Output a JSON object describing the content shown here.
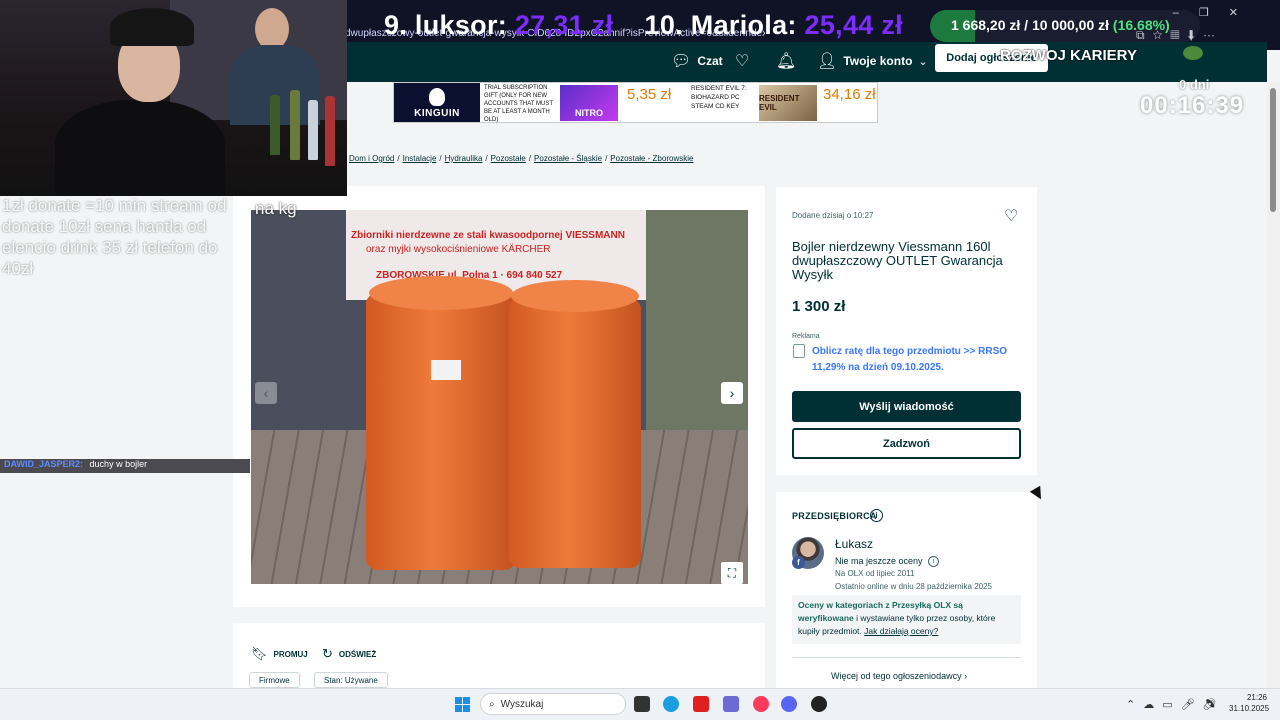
{
  "browser": {
    "url_text": "dwupłaszczowy-outlet-gwarancja-wysylk-CID628-ID2pxC2ahnif?isPreviewActive=0&sliderIndex=1"
  },
  "stream": {
    "scores": [
      {
        "rank_name": "9. luksor:",
        "amount": "27,31 zł"
      },
      {
        "rank_name": "10. Mariola:",
        "amount": "25,44 zł"
      }
    ],
    "goal": {
      "current": "1 668,20 zł",
      "sep": "/",
      "target": "10 000,00 zł",
      "percent": "(16.68%)",
      "progress": 0.1668
    },
    "kariery_label": "ROZWOJ KARIERY",
    "timer_small": "0 dni",
    "timer": "00:16:39",
    "overlay_text": "1zł donate =10 min stream od donate 10zł sena hantla od elencio drink 35 zł telefon do 40zł",
    "overlay_kg": "na kg",
    "chat_user": "DAWID_JASPER2:",
    "chat_msg": "duchy w bojler"
  },
  "header": {
    "chat_label": "Czat",
    "account_label": "Twoje konto",
    "add_label": "Dodaj ogłoszenie"
  },
  "ad_banner": {
    "brand": "KINGUIN",
    "product1_text": "TRIAL SUBSCRIPTION GIFT (ONLY FOR NEW ACCOUNTS THAT MUST BE AT LEAST A MONTH OLD)",
    "product1_image": "NITRO",
    "product1_price": "5,35 zł",
    "product2_text": "RESIDENT EVIL 7: BIOHAZARD PC STEAM CD KEY",
    "product2_image": "RESIDENT EVIL",
    "product2_price": "34,16 zł"
  },
  "breadcrumb": [
    "Dom i Ogród",
    "Instalacje",
    "Hydraulika",
    "Pozostałe",
    "Pozostałe - Śląskie",
    "Pozostałe - Zborowskie"
  ],
  "photo": {
    "banner_line1": "Zbiorniki nierdzewne ze stali kwasoodpornej VIESSMANN",
    "banner_line2": "oraz myjki wysokociśnieniowe KÄRCHER",
    "banner_contact": "ZBOROWSKIE ul. Polna 1 · 694 840 527"
  },
  "listing": {
    "added": "Dodane dzisiaj o 10:27",
    "title": "Bojler nierdzewny Viessmann 160l dwupłaszczowy OUTLET Gwarancja Wysyłk",
    "price": "1 300 zł",
    "ad_label": "Reklama",
    "calc_link": "Oblicz ratę dla tego przedmiotu >> RRSO 11,29% na dzień 09.10.2025.",
    "message_btn": "Wyślij wiadomość",
    "call_btn": "Zadzwoń"
  },
  "seller": {
    "type": "PRZEDSIĘBIORCA",
    "name": "Łukasz",
    "ratings": "Nie ma jeszcze oceny",
    "since": "Na OLX od lipiec 2011",
    "online": "Ostatnio online w dniu 28 października 2025",
    "ratings_box_bold": "Oceny w kategoriach z Przesyłką OLX są weryfikowane",
    "ratings_box_rest": " i wystawiane tylko przez osoby, które kupiły przedmiot. ",
    "ratings_box_link": "Jak działają oceny?",
    "more_ads": "Więcej od tego ogłoszeniodawcy"
  },
  "actions": {
    "promo": "PROMUJ",
    "refresh": "ODŚWIEŻ",
    "tags": [
      "Firmowe",
      "Stan: Używane"
    ]
  },
  "taskbar": {
    "search_placeholder": "Wyszukaj",
    "time": "21:26",
    "date": "31.10.2025"
  },
  "colors": {
    "olx_dark": "#002f34",
    "link_blue": "#3a77ff",
    "score_purple": "#7b2cff",
    "goal_green": "#4be37f"
  }
}
